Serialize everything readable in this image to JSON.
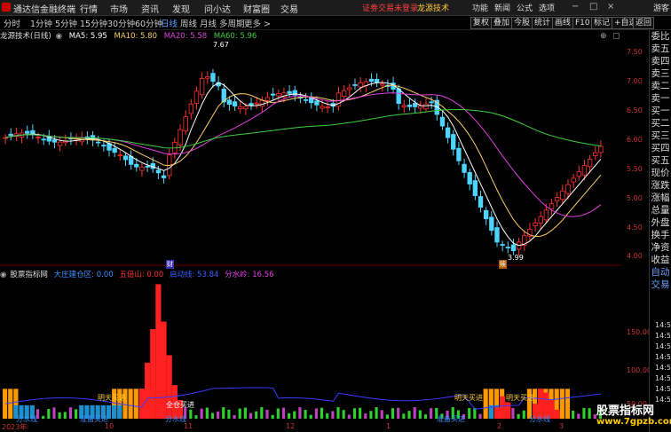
{
  "topbar": {
    "app_title": "通达信金融终端",
    "menus": [
      "行情",
      "市场",
      "资讯",
      "发现",
      "问小达",
      "财富圈",
      "交易"
    ],
    "promo_left": "证劵交易未登录",
    "promo_right": "龙源技术",
    "right_items": [
      "功能",
      "新闻",
      "公式",
      "选项"
    ],
    "guest": "游客"
  },
  "periods": [
    "分时",
    "1分钟",
    "5分钟",
    "15分钟",
    "30分钟",
    "60分钟",
    "日线",
    "周线",
    "月线",
    "多周期",
    "更多 >"
  ],
  "tools": [
    "复权",
    "叠加",
    "今股",
    "统计",
    "画线",
    "F10",
    "标记",
    "+自选",
    "返回"
  ],
  "main_panel": {
    "name": "龙源技术(日线)",
    "ma5": "MA5: 5.95",
    "ma10": "MA10: 5.80",
    "ma20": "MA20: 5.58",
    "ma60": "MA60: 5.96",
    "price_ticks": [
      "7.50",
      "7.00",
      "6.50",
      "6.00",
      "5.50",
      "5.00",
      "4.50",
      "4.00"
    ],
    "high_label": "7.67",
    "low_label": "3.99",
    "badge_cai": "财",
    "badge_hui": "赎"
  },
  "indicator_panel": {
    "name": "股票指标网",
    "item1": "大庄建仓区: 0.00",
    "item2": "五倍山: 0.00",
    "item3": "启动线: 53.84",
    "item4": "分水岭: 16.56",
    "ticks": [
      "150.00",
      "100.00",
      "50.00"
    ],
    "annotations": [
      "明天买进",
      "全仓买进",
      "明天买进",
      "明天买进",
      "准备买进",
      "准备买进",
      "分水线",
      "分水线",
      "分水线"
    ]
  },
  "sidebar": [
    "委比",
    "卖五",
    "卖四",
    "卖三",
    "卖二",
    "卖一",
    "买一",
    "买二",
    "买三",
    "买四",
    "买五",
    "现价",
    "涨跌",
    "涨幅",
    "总量",
    "外盘",
    "换手",
    "净资",
    "收益",
    "自动",
    "交易"
  ],
  "clock_ticks": [
    "14:55",
    "14:55",
    "14:55",
    "14:55",
    "14:55",
    "14:55",
    "14:55",
    "14:56"
  ],
  "time_axis": [
    "2023年",
    "10",
    "11",
    "12",
    "1",
    "2",
    "3"
  ],
  "watermark": "股票指标网",
  "watermark_url": "www.7gpzb.com",
  "chart_data": {
    "type": "candlestick",
    "y_range": [
      3.9,
      7.8
    ],
    "candles_count": 110,
    "high": 7.67,
    "low": 3.99
  }
}
